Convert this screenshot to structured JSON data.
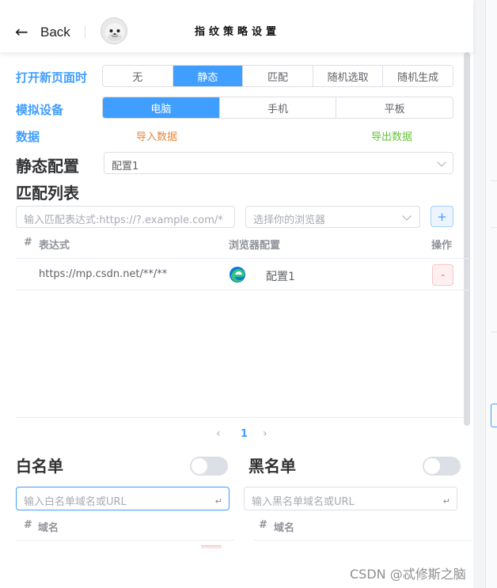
{
  "header": {
    "back_label": "Back",
    "title": "指纹策略设置"
  },
  "open_page": {
    "label": "打开新页面时",
    "options": [
      "无",
      "静态",
      "匹配",
      "随机选取",
      "随机生成"
    ],
    "selected": "静态"
  },
  "device": {
    "label": "模拟设备",
    "options": [
      "电脑",
      "手机",
      "平板"
    ],
    "selected": "电脑"
  },
  "data": {
    "label": "数据",
    "import_label": "导入数据",
    "export_label": "导出数据"
  },
  "static_config": {
    "heading": "静态配置",
    "value": "配置1"
  },
  "match_list": {
    "heading": "匹配列表",
    "expr_placeholder": "输入匹配表达式:https://?.example.com/*",
    "browser_placeholder": "选择你的浏览器",
    "add_label": "+",
    "columns": [
      "#",
      "表达式",
      "浏览器配置",
      "操作"
    ],
    "rows": [
      {
        "expression": "https://mp.csdn.net/**/**",
        "browser_icon": "edge-browser-icon",
        "config": "配置1",
        "delete_label": "-"
      }
    ]
  },
  "pagination": {
    "prev": "‹",
    "current": "1",
    "next": "›"
  },
  "whitelist": {
    "heading": "白名单",
    "enabled": false,
    "placeholder": "输入白名单域名或URL",
    "columns": [
      "#",
      "域名"
    ]
  },
  "blacklist": {
    "heading": "黑名单",
    "enabled": false,
    "placeholder": "输入黑名单域名或URL",
    "columns": [
      "#",
      "域名"
    ]
  },
  "watermark": "CSDN @忒修斯之脑",
  "colors": {
    "accent": "#409eff",
    "import": "#e6873c",
    "export": "#67c23a",
    "danger": "#f56c6c"
  }
}
